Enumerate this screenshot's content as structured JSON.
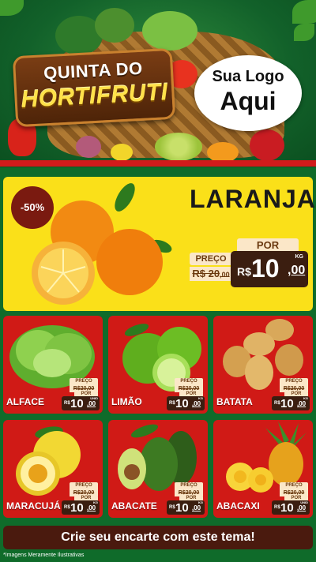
{
  "header": {
    "title_line1": "QUINTA DO",
    "title_line2": "HORTIFRUTI",
    "logo_line1": "Sua Logo",
    "logo_line2": "Aqui"
  },
  "featured": {
    "discount": "-50%",
    "name": "LARANJA",
    "por_label": "POR",
    "preco_label": "PREÇO",
    "old_price": "R$ 20,00",
    "old_price_main": "R$ 20",
    "old_price_cents": ",00",
    "currency": "R$",
    "price_main": "10",
    "price_cents": ",00",
    "unit": "KG"
  },
  "products": [
    {
      "name": "ALFACE",
      "preco_label": "PREÇO",
      "old_price": "R$20,00",
      "por_label": "POR",
      "currency": "R$",
      "price_main": "10",
      "price_cents": ",00",
      "unit": "UNID"
    },
    {
      "name": "LIMÃO",
      "preco_label": "PREÇO",
      "old_price": "R$20,00",
      "por_label": "POR",
      "currency": "R$",
      "price_main": "10",
      "price_cents": ",00",
      "unit": "KG"
    },
    {
      "name": "BATATA",
      "preco_label": "PREÇO",
      "old_price": "R$20,00",
      "por_label": "POR",
      "currency": "R$",
      "price_main": "10",
      "price_cents": ",00",
      "unit": "KG"
    },
    {
      "name": "MARACUJÁ",
      "preco_label": "PREÇO",
      "old_price": "R$20,00",
      "por_label": "POR",
      "currency": "R$",
      "price_main": "10",
      "price_cents": ",00",
      "unit": "KG"
    },
    {
      "name": "ABACATE",
      "preco_label": "PREÇO",
      "old_price": "R$20,00",
      "por_label": "POR",
      "currency": "R$",
      "price_main": "10",
      "price_cents": ",00",
      "unit": "KG"
    },
    {
      "name": "ABACAXI",
      "preco_label": "PREÇO",
      "old_price": "R$20,00",
      "por_label": "POR",
      "currency": "R$",
      "price_main": "10",
      "price_cents": ",00",
      "unit": "UNID"
    }
  ],
  "footer": {
    "cta": "Crie seu encarte com este tema!",
    "disclaimer": "*Imagens Meramente Ilustrativas"
  },
  "colors": {
    "background_green": "#0f6b2a",
    "card_red": "#d01a16",
    "featured_yellow": "#fae019",
    "price_brown": "#3b1e10",
    "title_yellow": "#ffe14a"
  }
}
